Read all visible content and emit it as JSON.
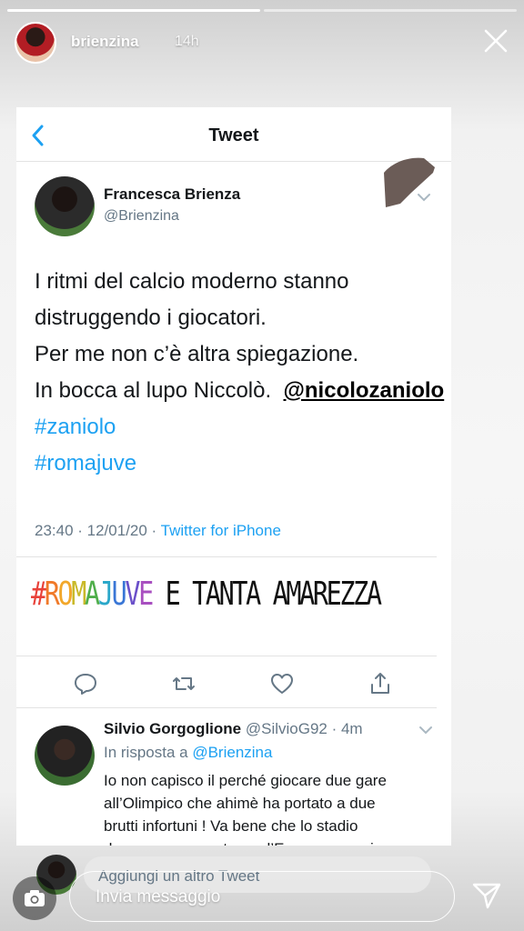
{
  "story": {
    "username": "brienzina",
    "time_ago": "14h",
    "progress": [
      1.0,
      0.0
    ]
  },
  "tweet_screen": {
    "nav_title": "Tweet",
    "author_name": "Francesca Brienza",
    "author_handle": "@Brienzina",
    "body_lines": [
      "I ritmi del calcio moderno stanno",
      "distruggendo i giocatori.",
      "Per me non c’è altra spiegazione."
    ],
    "body_line4_text": "In bocca al lupo Niccolò.  ",
    "mention": "@nicolozaniolo",
    "hashtags": [
      "#zaniolo",
      "#romajuve"
    ],
    "meta_datetime": "23:40 · 12/01/20 · ",
    "meta_source": "Twitter for iPhone",
    "banner": {
      "hashtag": "#ROMAJUVE",
      "rest": " E TANTA AMAREZZA",
      "rainbow_colors": [
        "#e8423a",
        "#f07a2a",
        "#f2a72a",
        "#c9b92a",
        "#4fae4a",
        "#2aa7c9",
        "#3a77d6",
        "#6a4fc9",
        "#a84fc0"
      ],
      "text_color": "#111111"
    },
    "actions": [
      "reply-icon",
      "retweet-icon",
      "like-icon",
      "share-icon"
    ]
  },
  "reply": {
    "name": "Silvio Gorgoglione",
    "handle_time": " @SilvioG92 · 4m",
    "replying_label": "In risposta a ",
    "replying_to": "@Brienzina",
    "text_lines": [
      "Io non capisco il perché giocare due gare",
      "all’Olimpico che ahimè ha portato a due",
      "brutti infortuni ! Va bene che lo stadio",
      "dovo essere pronto per l’Europeo ma ci"
    ]
  },
  "compose": {
    "placeholder": "Aggiungi un altro Tweet"
  },
  "footer": {
    "message_placeholder": "Invia messaggio"
  },
  "colors": {
    "twitter_blue": "#1da1f2",
    "muted": "#657786",
    "text": "#14171a"
  }
}
